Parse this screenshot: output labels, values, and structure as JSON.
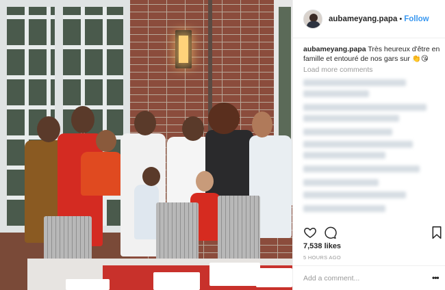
{
  "post": {
    "photo_alt": "Group photo",
    "username": "aubameyang.papa",
    "separator": "•",
    "follow_label": "Follow"
  },
  "caption": {
    "username": "aubameyang.papa",
    "text": "Très heureux d'être en famille et entouré de nos gars sur",
    "emojis": "👏😘"
  },
  "comments": {
    "load_more_label": "Load more comments"
  },
  "actions": {
    "like_icon": "heart-icon",
    "comment_icon": "comment-icon",
    "save_icon": "bookmark-icon"
  },
  "stats": {
    "likes": "7,538 likes",
    "timestamp": "5 HOURS AGO"
  },
  "add_comment": {
    "placeholder": "Add a comment...",
    "more_label": "•••"
  },
  "colors": {
    "link": "#3897f0",
    "text": "#262626",
    "muted": "#999999",
    "border": "#efefef"
  }
}
